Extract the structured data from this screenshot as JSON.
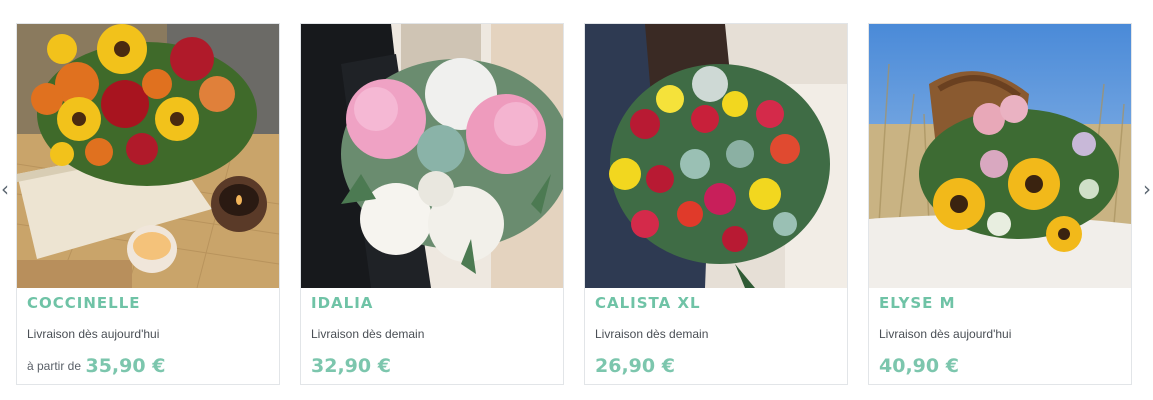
{
  "carousel": {
    "prev_icon": "chevron-left-icon",
    "next_icon": "chevron-right-icon",
    "products": [
      {
        "name": "COCCINELLE",
        "delivery": "Livraison dès aujourd'hui",
        "price_prefix": "à partir de",
        "price": "35,90 €",
        "image": "sunflower-rose-bouquet-image"
      },
      {
        "name": "IDALIA",
        "delivery": "Livraison dès demain",
        "price_prefix": "",
        "price": "32,90 €",
        "image": "hydrangea-bouquet-image"
      },
      {
        "name": "CALISTA XL",
        "delivery": "Livraison dès demain",
        "price_prefix": "",
        "price": "26,90 €",
        "image": "mixed-rose-bouquet-image"
      },
      {
        "name": "ELYSE M",
        "delivery": "Livraison dès aujourd'hui",
        "price_prefix": "",
        "price": "40,90 €",
        "image": "sunflower-basket-bouquet-image"
      }
    ]
  },
  "colors": {
    "accent": "#6fc3a6",
    "price": "#7cc6ad",
    "text": "#4a4f55",
    "border": "#e2e5e8"
  }
}
